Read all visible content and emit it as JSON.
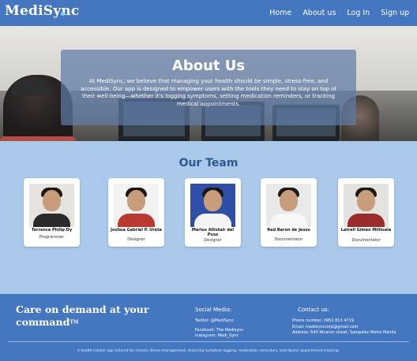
{
  "nav": {
    "logo": "MediSync",
    "links": [
      "Home",
      "About us",
      "Log In",
      "Sign up"
    ]
  },
  "hero": {
    "title": "About Us",
    "text": "At MediSync, we believe that managing your health should be simple, stress-free, and accessible. Our app is designed to empower users with the tools they need to stay on top of their well-being—whether it's logging symptoms, setting medication reminders, or tracking medical appointments."
  },
  "team": {
    "title": "Our Team",
    "members": [
      {
        "name": "Terrence Philip Dy",
        "role": "Programmer"
      },
      {
        "name": "Joshua Gabriel P. Ureta",
        "role": "Designer"
      },
      {
        "name": "Marius Allistair del Poso",
        "role": "Designer"
      },
      {
        "name": "Red Baron de Jesus",
        "role": "Documentator"
      },
      {
        "name": "Latrell Gimeo Militsala",
        "role": "Documentator"
      }
    ]
  },
  "footer": {
    "tagline": "Care on demand at your command",
    "tm": "TM",
    "social": {
      "title": "Social Media:",
      "lines": [
        "Twitter: @MediSync",
        "Facebook: The Medisync",
        "Instagram: Medi_Sync"
      ]
    },
    "contact": {
      "title": "Contact us:",
      "lines": [
        "Phone number: 0952 813 4719",
        "Email: medisynccorp@gmail.com",
        "Address: 643 Nicanor street, Sampaloc Metro Manila"
      ]
    },
    "note": "A health tracker app tailored for chronic illness management, featuring symptom logging, medication reminders, and doctor appointment tracking."
  },
  "colors": {
    "brand": "#4577c1",
    "section_bg": "#a9c8ea",
    "heading": "#2c5a8e"
  }
}
